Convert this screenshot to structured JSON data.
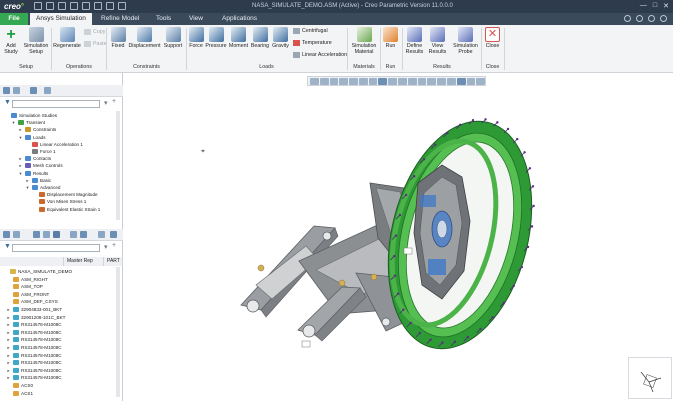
{
  "app": {
    "logo_text": "creo",
    "window_title": "NASA_SIMULATE_DEMO.ASM (Active) - Creo Parametric Version 11.0.0.0"
  },
  "tabs": [
    {
      "label": "File"
    },
    {
      "label": "Ansys Simulation"
    },
    {
      "label": "Refine Model"
    },
    {
      "label": "Tools"
    },
    {
      "label": "View"
    },
    {
      "label": "Applications"
    }
  ],
  "ribbon": {
    "setup": {
      "group": "Setup",
      "new_study": "Add Study",
      "sim_setup": "Simulation Setup"
    },
    "operations": {
      "group": "Operations",
      "regenerate": "Regenerate",
      "copy": "Copy",
      "paste": "Paste"
    },
    "constraints": {
      "group": "Constraints",
      "fixed": "Fixed",
      "displacement": "Displacement",
      "support": "Support"
    },
    "loads": {
      "group": "Loads",
      "force": "Force",
      "pressure": "Pressure",
      "moment": "Moment",
      "bearing": "Bearing",
      "gravity": "Gravity",
      "centrifugal": "Centrifugal",
      "temperature": "Temperature",
      "linear_acc": "Linear Acceleration"
    },
    "materials": {
      "group": "Materials",
      "sim_material": "Simulation Material"
    },
    "run": {
      "group": "Run",
      "run": "Run"
    },
    "results": {
      "group": "Results",
      "define_results": "Define Results",
      "view_results": "View Results",
      "sim_probe": "Simulation Probe"
    },
    "close": {
      "group": "Close",
      "close": "Close"
    }
  },
  "sim_tree": [
    {
      "label": "Simulation Studies",
      "indent": 0,
      "toggle": ""
    },
    {
      "label": "Transient",
      "indent": 1,
      "toggle": "▾"
    },
    {
      "label": "Constraints",
      "indent": 2,
      "toggle": "▸"
    },
    {
      "label": "Loads",
      "indent": 2,
      "toggle": "▾"
    },
    {
      "label": "Linear Acceleration 1",
      "indent": 3,
      "toggle": ""
    },
    {
      "label": "Force 1",
      "indent": 3,
      "toggle": ""
    },
    {
      "label": "Contacts",
      "indent": 2,
      "toggle": "▸"
    },
    {
      "label": "Mesh Controls",
      "indent": 2,
      "toggle": "▸"
    },
    {
      "label": "Results",
      "indent": 2,
      "toggle": "▾"
    },
    {
      "label": "Basic",
      "indent": 3,
      "toggle": "▸"
    },
    {
      "label": "Advanced",
      "indent": 3,
      "toggle": "▾"
    },
    {
      "label": "Displacement Magnitude",
      "indent": 4,
      "toggle": ""
    },
    {
      "label": "Von Mises Stress 1",
      "indent": 4,
      "toggle": ""
    },
    {
      "label": "Equivalent Elastic Strain 1",
      "indent": 4,
      "toggle": ""
    }
  ],
  "model_tree": {
    "col_master": "Master Rep",
    "col_part": "PART",
    "items": [
      "NASA_SIMULATE_DEMO",
      "ASM_RIGHT",
      "ASM_TOP",
      "ASM_FRONT",
      "ASM_DEF_CSYS",
      "32904833-001_BKT",
      "32901208-101C_BKT",
      "RS314578-M1008C",
      "RS314578-M1008C",
      "RS314578-M1008C",
      "RS314578-M1008C",
      "RS314578-M1008C",
      "RS314578-M1008C",
      "RS314578-M1008C",
      "RS314578-M1008C",
      "ACS0",
      "ACS1"
    ]
  },
  "colors": {
    "ring_green": "#35a83a",
    "bracket_gray": "#8c8f92",
    "accent_blue": "#2c6fb3",
    "file_tab": "#34a853"
  }
}
